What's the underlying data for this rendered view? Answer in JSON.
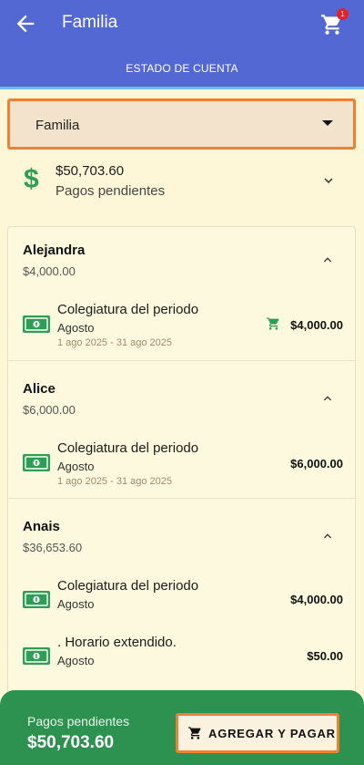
{
  "appbar": {
    "title": "Familia",
    "cart_count": "1",
    "subtitle": "ESTADO DE CUENTA"
  },
  "selector": {
    "value": "Familia"
  },
  "summary": {
    "amount": "$50,703.60",
    "caption": "Pagos pendientes"
  },
  "sections": [
    {
      "name": "Alejandra",
      "total": "$4,000.00",
      "items": [
        {
          "title": "Colegiatura del periodo",
          "month": "Agosto",
          "range": "1 ago 2025 - 31 ago 2025",
          "amount": "$4,000.00",
          "in_cart": true
        }
      ]
    },
    {
      "name": "Alice",
      "total": "$6,000.00",
      "items": [
        {
          "title": "Colegiatura del periodo",
          "month": "Agosto",
          "range": "1 ago 2025 - 31 ago 2025",
          "amount": "$6,000.00",
          "in_cart": false
        }
      ]
    },
    {
      "name": "Anais",
      "total": "$36,653.60",
      "items": [
        {
          "title": "Colegiatura del periodo",
          "month": "Agosto",
          "amount": "$4,000.00",
          "in_cart": false
        },
        {
          "title": ". Horario extendido.",
          "month": "Agosto",
          "amount": "$50.00",
          "in_cart": false
        }
      ]
    }
  ],
  "footer": {
    "label": "Pagos pendientes",
    "amount": "$50,703.60",
    "button_label": "AGREGAR Y PAGAR"
  },
  "colors": {
    "appbar": "#5468d4",
    "accent_green": "#2e9e54",
    "footer_green": "#2d9250",
    "focus_orange": "#f07f34",
    "badge_red": "#e5222a"
  }
}
